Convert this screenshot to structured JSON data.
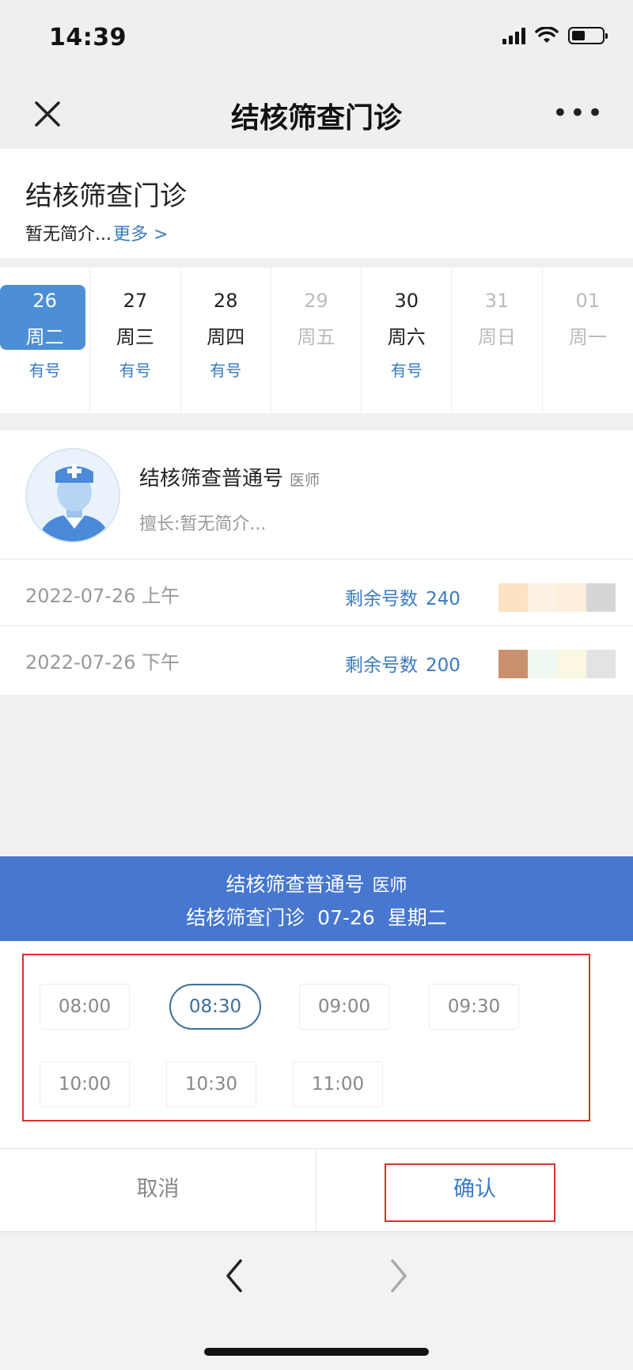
{
  "status_bar": {
    "time": "14:39",
    "battery_level": 0.45
  },
  "nav": {
    "title": "结核筛查门诊",
    "more": "•••",
    "close_icon": "close-icon"
  },
  "clinic": {
    "name": "结核筛查门诊",
    "brief": "暂无简介...",
    "more_link": "更多 >"
  },
  "dates": [
    {
      "day": "26",
      "week": "周二",
      "status": "有号",
      "selected": true,
      "available": true
    },
    {
      "day": "27",
      "week": "周三",
      "status": "有号",
      "selected": false,
      "available": true
    },
    {
      "day": "28",
      "week": "周四",
      "status": "有号",
      "selected": false,
      "available": true
    },
    {
      "day": "29",
      "week": "周五",
      "status": "",
      "selected": false,
      "available": false
    },
    {
      "day": "30",
      "week": "周六",
      "status": "有号",
      "selected": false,
      "available": true
    },
    {
      "day": "31",
      "week": "周日",
      "status": "",
      "selected": false,
      "available": false
    },
    {
      "day": "01",
      "week": "周一",
      "status": "",
      "selected": false,
      "available": false
    }
  ],
  "doctor": {
    "name": "结核筛查普通号",
    "title": "医师",
    "skill": "擅长:暂无简介...",
    "avatar_icon": "doctor-avatar-icon",
    "slots": [
      {
        "date": "2022-07-26 上午",
        "remain_label": "剩余号数",
        "remain_count": "240",
        "blur_colors": [
          "#fde2c3",
          "#fdf1e4",
          "#fcefdc",
          "#d6d6d6"
        ]
      },
      {
        "date": "2022-07-26 下午",
        "remain_label": "剩余号数",
        "remain_count": "200",
        "blur_colors": [
          "#c9906e",
          "#f0f8f2",
          "#fbf7e3",
          "#e3e3e3"
        ]
      }
    ]
  },
  "sheet": {
    "line1_name": "结核筛查普通号",
    "line1_title": "医师",
    "line2": "结核筛查门诊  07-26  星期二",
    "times": [
      {
        "label": "08:00",
        "selected": false
      },
      {
        "label": "08:30",
        "selected": true
      },
      {
        "label": "09:00",
        "selected": false
      },
      {
        "label": "09:30",
        "selected": false
      },
      {
        "label": "10:00",
        "selected": false
      },
      {
        "label": "10:30",
        "selected": false
      },
      {
        "label": "11:00",
        "selected": false
      }
    ],
    "cancel": "取消",
    "confirm": "确认"
  },
  "colors": {
    "accent": "#3a7bbf",
    "selected_date": "#4d8fd6",
    "sheet_header": "#4777cf",
    "highlight_frame": "#d9322b"
  },
  "browser_bar": {
    "back_icon": "chevron-left-icon",
    "forward_icon": "chevron-right-icon"
  }
}
